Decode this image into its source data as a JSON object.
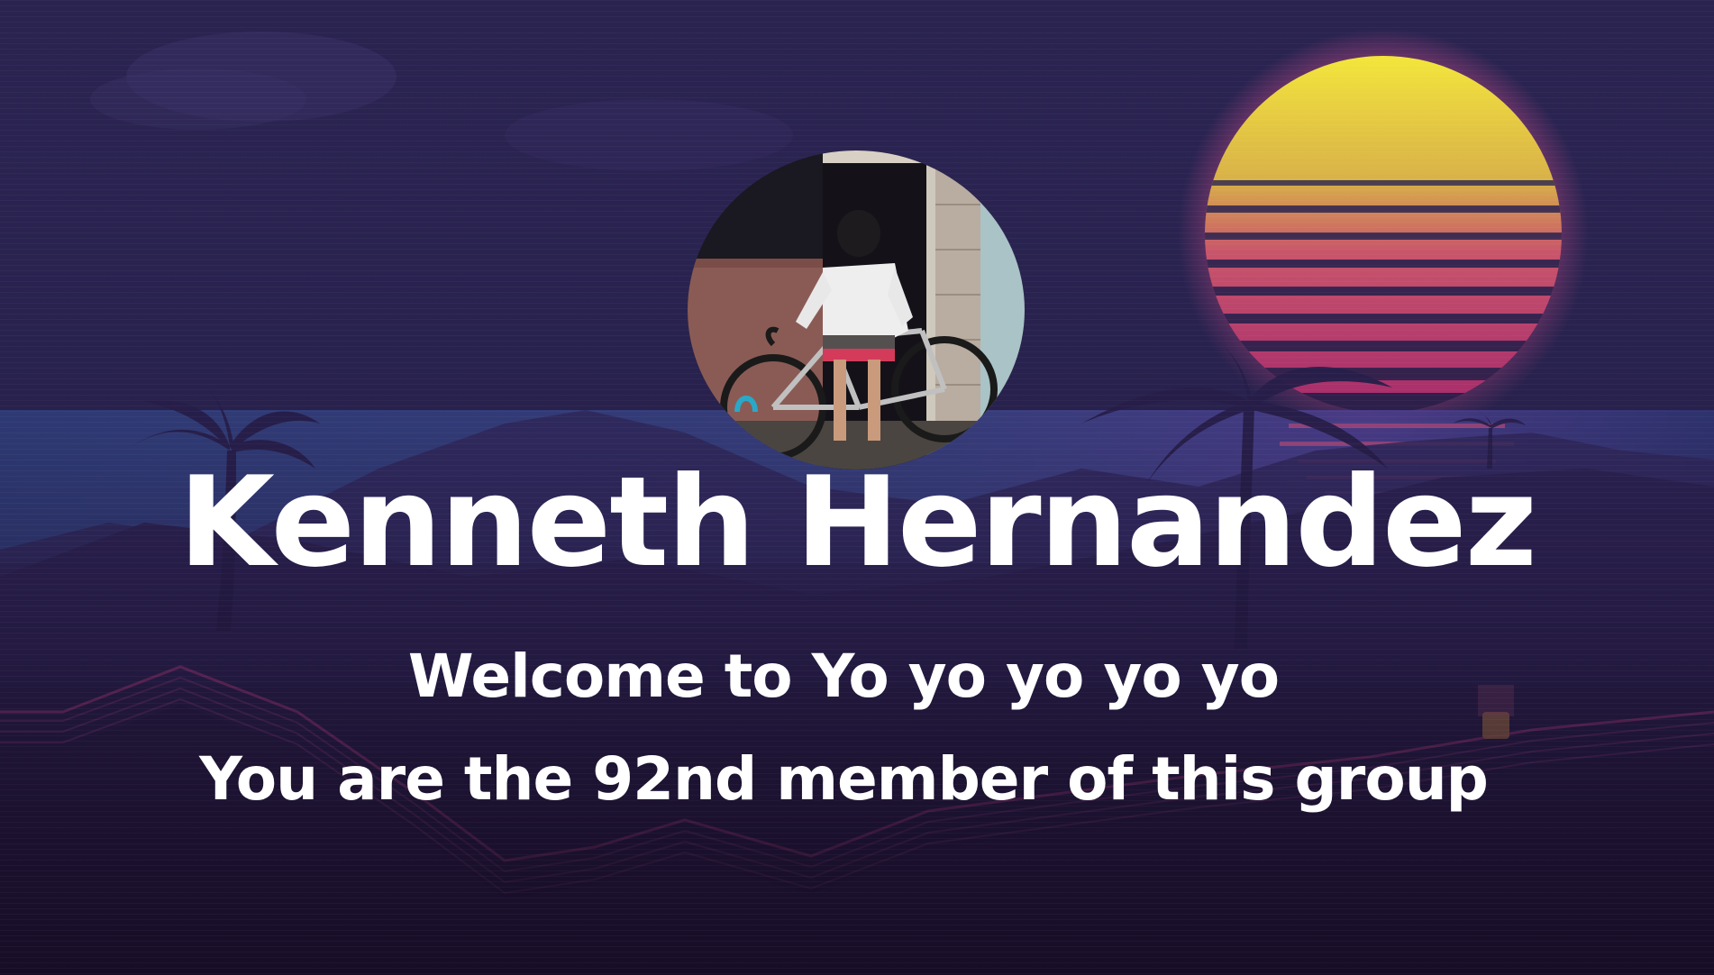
{
  "card": {
    "member_name": "Kenneth Hernandez",
    "welcome_text": "Welcome to Yo yo yo yo yo",
    "member_text": "You are the 92nd member of this group"
  },
  "background": {
    "scene": "synthwave-sunset",
    "colors": {
      "sky": "#2b2553",
      "sun_top": "#fff03c",
      "sun_bottom": "#ff3c8c",
      "mountain_neon": "#e04a9c",
      "water": "#3c5aa6"
    }
  },
  "icons": {
    "avatar": "profile-photo-person-with-bicycle"
  }
}
